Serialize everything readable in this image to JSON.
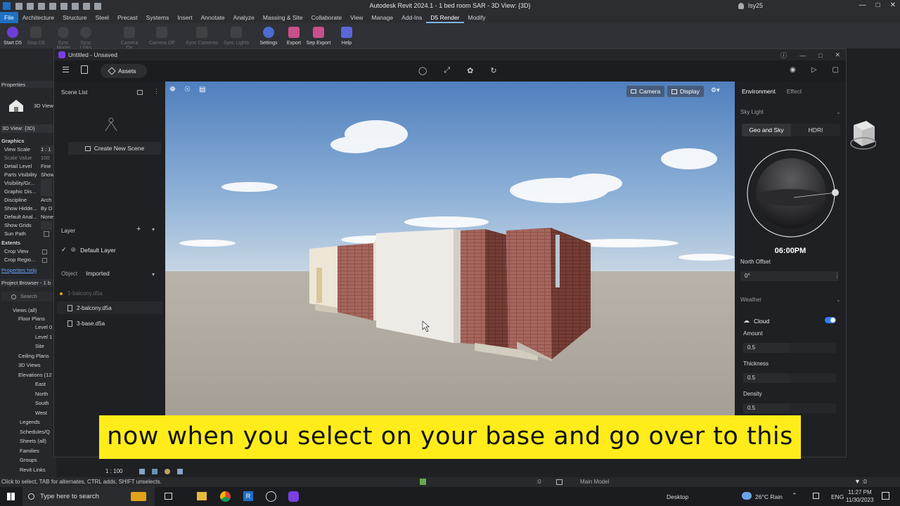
{
  "revit": {
    "app_title": "Autodesk Revit 2024.1 - 1 bed room SAR - 3D View: {3D}",
    "user": "lsy25",
    "tabs": [
      "File",
      "Architecture",
      "Structure",
      "Steel",
      "Precast",
      "Systems",
      "Insert",
      "Annotate",
      "Analyze",
      "Massing & Site",
      "Collaborate",
      "View",
      "Manage",
      "Add-Ins",
      "D5 Render",
      "Modify"
    ],
    "ribbon": {
      "start": "Start D5",
      "stop": "Stop D5",
      "sync_model": "Sync Model",
      "sync_links": "Sync Links",
      "camera_on": "Camera On",
      "camera_off": "Camera Off",
      "sync_cameras": "Sync Cameras",
      "sync_lights": "Sync Lights",
      "settings": "Settings",
      "export": "Export",
      "sep_export": "Sep Export",
      "help": "Help"
    }
  },
  "properties": {
    "header": "Properties",
    "type": "3D View",
    "selector": "3D View: {3D}",
    "group_graphics": "Graphics",
    "rows": [
      [
        "View Scale",
        "1 : 1"
      ],
      [
        "Scale Value",
        "100"
      ],
      [
        "Detail Level",
        "Fine"
      ],
      [
        "Parts Visibility",
        "Show"
      ],
      [
        "Visibility/Gr...",
        ""
      ],
      [
        "Graphic Dis...",
        ""
      ],
      [
        "Discipline",
        "Arch"
      ],
      [
        "Show Hidde...",
        "By D"
      ],
      [
        "Default Anal...",
        "None"
      ],
      [
        "Show Grids",
        ""
      ],
      [
        "Sun Path",
        ""
      ]
    ],
    "group_extents": "Extents",
    "extents": [
      "Crop View",
      "Crop Regio..."
    ],
    "help_link": "Properties help"
  },
  "browser": {
    "header": "Project Browser - 1 b",
    "search": "Search",
    "items": [
      "Views (all)",
      "Floor Plans",
      "Level 0",
      "Level 1",
      "Site",
      "Ceiling Plans",
      "3D Views",
      "Elevations (12",
      "East",
      "North",
      "South",
      "West",
      "Legends",
      "Schedules/Q",
      "Sheets (all)",
      "Families",
      "Groups",
      "Revit Links"
    ]
  },
  "d5": {
    "window_title": "Untitled - Unsaved",
    "assets": "Assets",
    "scene_list": "Scene List",
    "create_scene": "Create New Scene",
    "layer": "Layer",
    "default_layer": "Default Layer",
    "object": "Object",
    "imported": "Imported",
    "objects": [
      "1-balcony.d5a",
      "2-balcony.d5a",
      "3-base.d5a"
    ],
    "camera": "Camera",
    "display": "Display",
    "env_tab": "Environment",
    "effect_tab": "Effect",
    "sky_light": "Sky Light",
    "geo_sky": "Geo and Sky",
    "hdri": "HDRI",
    "time": "06:00PM",
    "north_offset": "North Offset",
    "north_value": "0°",
    "weather": "Weather",
    "cloud": "Cloud",
    "amount": "Amount",
    "amount_val": "0.5",
    "thickness": "Thickness",
    "thickness_val": "0.5",
    "density": "Density",
    "density_val": "0.5"
  },
  "caption": "now when you select on your base and go over to this",
  "status": {
    "hint": "Click to select, TAB for alternates, CTRL adds, SHIFT unselects.",
    "scale": "1 : 100",
    "zero": ":0",
    "model": "Main Model",
    "filter": ":0"
  },
  "taskbar": {
    "search": "Type here to search",
    "desktop": "Desktop",
    "weather": "26°C  Rain",
    "lang": "ENG",
    "time": "11:27 PM",
    "date": "11/30/2023"
  }
}
